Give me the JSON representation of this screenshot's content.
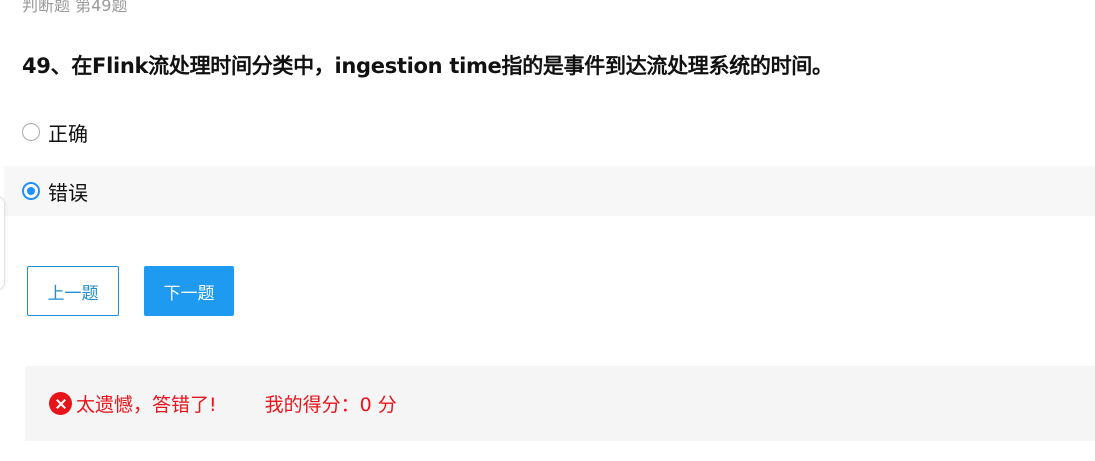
{
  "breadcrumb": "判断题 第49题",
  "question": {
    "text": "49、在Flink流处理时间分类中，ingestion time指的是事件到达流处理系统的时间。"
  },
  "options": [
    {
      "label": "正确",
      "selected": false
    },
    {
      "label": "错误",
      "selected": true
    }
  ],
  "navigation": {
    "prev_label": "上一题",
    "next_label": "下一题"
  },
  "result": {
    "message": "太遗憾，答错了!",
    "score_text": "我的得分：0 分",
    "icon": "close-circle-icon",
    "color": "#e8141b"
  },
  "colors": {
    "accent": "#1e9bf0",
    "error": "#e8141b"
  }
}
